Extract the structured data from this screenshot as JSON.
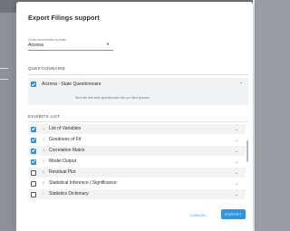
{
  "dialog": {
    "title": "Export Filings support",
    "state_select": {
      "label": "Show documents by state",
      "value": "Arizona"
    }
  },
  "questionnaire": {
    "header": "QUESTIONNAIRE",
    "item": {
      "title": "Arizona - State Questionnaire",
      "description": "Word file with state questionnaire with pre-filled answers",
      "checked": true
    }
  },
  "exhibits": {
    "header": "EXHIBITS LIST",
    "items": [
      {
        "num": "1",
        "label": "List of Variables",
        "checked": true
      },
      {
        "num": "2",
        "label": "Goodness of Fit",
        "checked": true
      },
      {
        "num": "3",
        "label": "Correlation Matrix",
        "checked": true
      },
      {
        "num": "4",
        "label": "Model Output",
        "checked": true
      },
      {
        "num": "5",
        "label": "Residual Plot",
        "checked": false
      },
      {
        "num": "6",
        "label": "Statistical Inference / Significance",
        "checked": false
      },
      {
        "num": "7",
        "label": "Statistics Dictionary",
        "checked": false
      }
    ]
  },
  "actions": {
    "cancel": "CANCEL",
    "export": "EXPORT"
  },
  "colors": {
    "accent": "#2f8fd8",
    "row_alt": "#f1f3f5"
  },
  "icons": {
    "checkbox_checked": "check-icon",
    "expand": "chevron-down-icon",
    "collapse": "chevron-up-icon",
    "dropdown": "caret-down-icon"
  }
}
